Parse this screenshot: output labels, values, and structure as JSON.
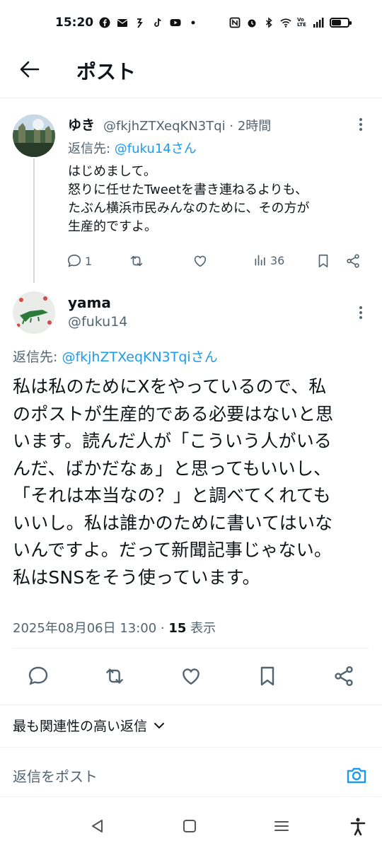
{
  "status_bar": {
    "time": "15:20",
    "left_icons": [
      "facebook-icon",
      "mail-icon",
      "app-icon",
      "tiktok-icon",
      "youtube-icon",
      "dot-icon"
    ],
    "right_icons": [
      "nfc-icon",
      "alarm-icon",
      "bluetooth-icon",
      "wifi-icon",
      "volte-icon",
      "signal-icon",
      "battery-icon"
    ],
    "volte_label": "Vo LTE",
    "battery_level": 0.6
  },
  "header": {
    "title": "ポスト"
  },
  "reply_tweet": {
    "name": "ゆき",
    "handle_time": "@fkjhZTXeqKN3Tqi · 2時間",
    "reply_to_prefix": "返信先: ",
    "reply_to_handle": "@fuku14さん",
    "body": [
      "はじめまして。",
      "怒りに任せたTweetを書き連ねるよりも、",
      "たぶん横浜市民みんなのために、その方が",
      "生産的ですよ。"
    ],
    "replies": "1",
    "views": "36"
  },
  "main_tweet": {
    "name": "yama",
    "handle": "@fuku14",
    "reply_to_prefix": "返信先: ",
    "reply_to_handle": "@fkjhZTXeqKN3Tqiさん",
    "body": [
      "私は私のためにXをやっているので、私",
      "のポストが生産的である必要はないと思",
      "います。読んだ人が「こういう人がいる",
      "んだ、ばかだなぁ」と思ってもいいし、",
      "「それは本当なの？」と調べてくれても",
      "いいし。私は誰かのために書いてはいな",
      "いんですよ。だって新聞記事じゃない。",
      "私はSNSをそう使っています。"
    ],
    "timestamp": "2025年08月06日 13:00 · ",
    "view_count": "15",
    "view_label": " 表示"
  },
  "sort": {
    "label": "最も関連性の高い返信"
  },
  "compose": {
    "placeholder": "返信をポスト"
  },
  "colors": {
    "accent": "#1d9bf0",
    "muted": "#536471",
    "text": "#0f1419"
  }
}
